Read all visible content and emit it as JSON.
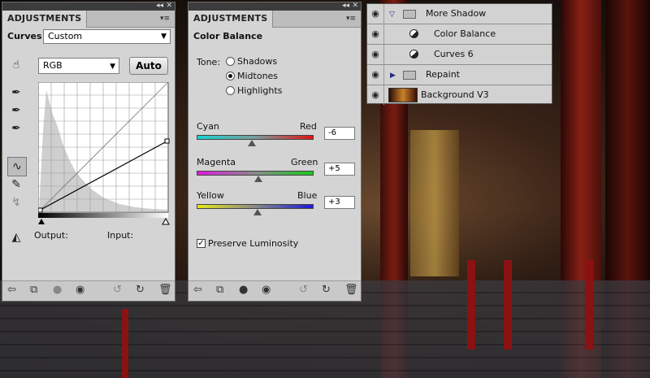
{
  "curves_panel": {
    "tab_title": "ADJUSTMENTS",
    "adjustment_name": "Curves",
    "preset_value": "Custom",
    "channel_value": "RGB",
    "auto_label": "Auto",
    "output_label": "Output:",
    "input_label": "Input:"
  },
  "color_balance_panel": {
    "tab_title": "ADJUSTMENTS",
    "adjustment_name": "Color Balance",
    "tone_label": "Tone:",
    "tone_options": [
      "Shadows",
      "Midtones",
      "Highlights"
    ],
    "selected_tone": "Midtones",
    "sliders": [
      {
        "left": "Cyan",
        "right": "Red",
        "value": "-6",
        "level": -6
      },
      {
        "left": "Magenta",
        "right": "Green",
        "value": "+5",
        "level": 5
      },
      {
        "left": "Yellow",
        "right": "Blue",
        "value": "+3",
        "level": 3
      }
    ],
    "preserve_luminosity_label": "Preserve Luminosity",
    "preserve_luminosity_checked": true
  },
  "layers": [
    {
      "name": "More Shadow",
      "type": "group-open"
    },
    {
      "name": "Color Balance",
      "type": "adjustment"
    },
    {
      "name": "Curves 6",
      "type": "adjustment"
    },
    {
      "name": "Repaint",
      "type": "group-closed"
    },
    {
      "name": "Background V3",
      "type": "image"
    }
  ],
  "colors": {
    "panel_bg": "#d4d4d4",
    "titlebar": "#3c3c3c",
    "scene_red": "#8a1212"
  },
  "icons": [
    "close-icon",
    "panel-menu-icon",
    "collapse-icon",
    "eye-icon",
    "folder-icon",
    "adjustment-layer-icon",
    "back-arrow-icon",
    "clip-icon",
    "visibility-icon",
    "reset-icon",
    "trash-icon",
    "eyedropper-icon",
    "curve-icon",
    "pencil-icon",
    "hand-adjust-icon"
  ]
}
